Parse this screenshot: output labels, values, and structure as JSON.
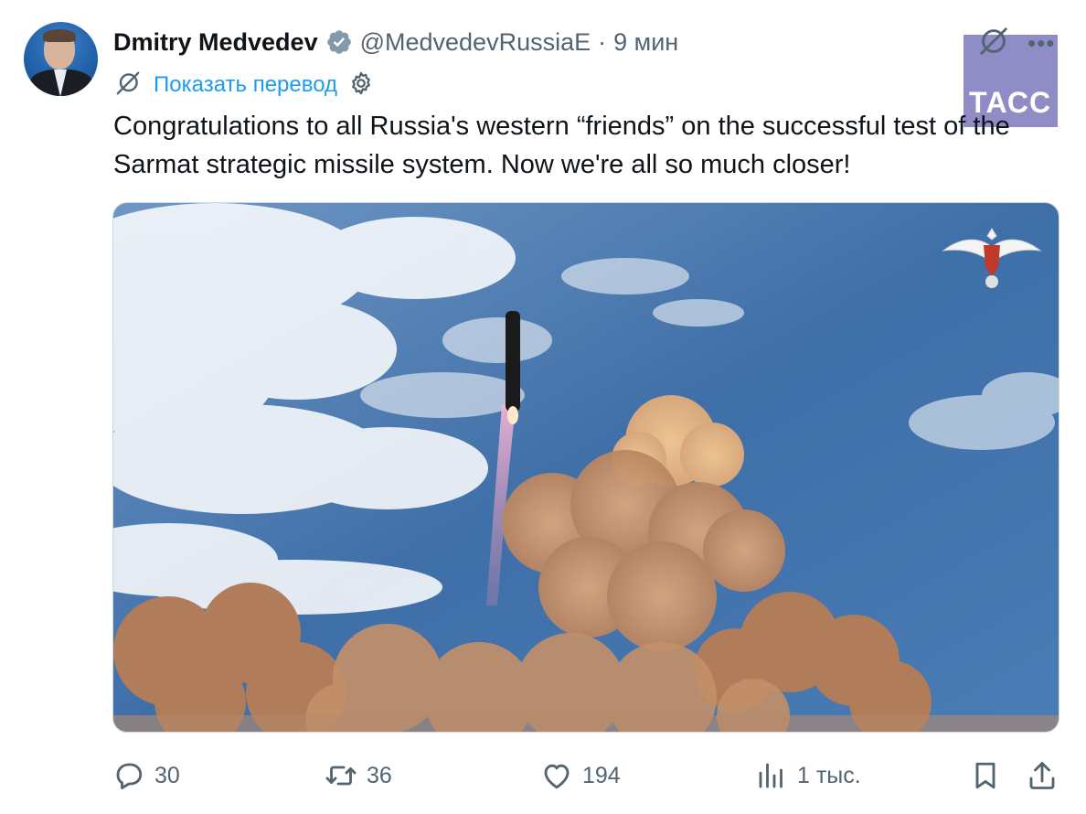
{
  "tweet": {
    "author_name": "Dmitry Medvedev",
    "handle": "@MedvedevRussiaE",
    "separator": "·",
    "time": "9 мин",
    "translate_label": "Показать перевод",
    "text": "Congratulations to all Russia's western “friends” on the successful test of the Sarmat strategic missile system. Now we're all so much closer!",
    "watermark": "ТАСС"
  },
  "actions": {
    "replies": "30",
    "reposts": "36",
    "likes": "194",
    "views": "1 тыс."
  },
  "icons": {
    "verified": "verified-badge-icon",
    "grok": "grok-icon",
    "more": "more-icon",
    "settings": "gear-icon",
    "reply": "reply-icon",
    "repost": "repost-icon",
    "like": "heart-icon",
    "views": "analytics-icon",
    "bookmark": "bookmark-icon",
    "share": "share-icon"
  },
  "colors": {
    "link": "#1d9bf0",
    "muted": "#536471",
    "text": "#0f1419",
    "watermark_bg": "#8f8cc6"
  }
}
